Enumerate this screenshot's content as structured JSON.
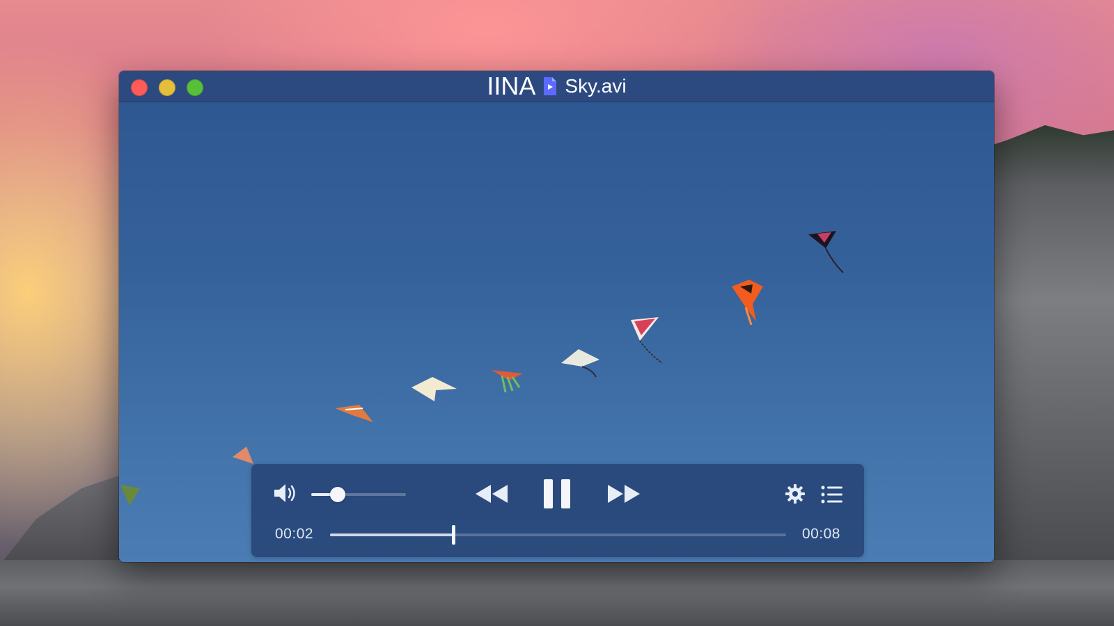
{
  "window": {
    "app_name": "IINA",
    "file_icon": "video-file-icon",
    "file_name": "Sky.avi",
    "traffic_lights": {
      "close_color": "#fc5b57",
      "minimize_color": "#e5bf3c",
      "maximize_color": "#57c038"
    }
  },
  "video": {
    "description_icon": "kites-scene"
  },
  "controls": {
    "volume_icon": "speaker-icon",
    "volume_level": 0.28,
    "rewind_icon": "rewind-icon",
    "pause_icon": "pause-icon",
    "fast_forward_icon": "fast-forward-icon",
    "settings_icon": "gear-icon",
    "playlist_icon": "list-icon",
    "current_time": "00:02",
    "total_time": "00:08",
    "progress": 0.27
  },
  "colors": {
    "titlebar": "#2d4a80",
    "osc_background": "#284678",
    "accent_white": "#f4f6fa"
  }
}
